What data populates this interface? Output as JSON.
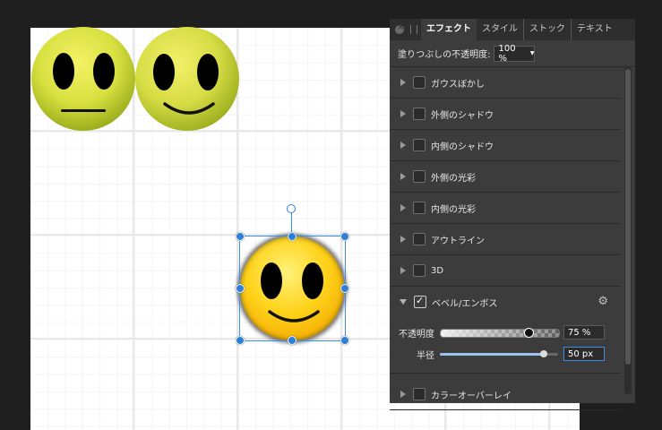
{
  "panel": {
    "tabs": [
      {
        "label": "エフェクト",
        "active": true
      },
      {
        "label": "スタイル"
      },
      {
        "label": "ストック"
      },
      {
        "label": "テキスト"
      }
    ],
    "fill_opacity_label": "塗りつぶしの不透明度:",
    "fill_opacity_value": "100 %",
    "effects": [
      {
        "label": "ガウスぼかし",
        "checked": false
      },
      {
        "label": "外側のシャドウ",
        "checked": false
      },
      {
        "label": "内側のシャドウ",
        "checked": false
      },
      {
        "label": "外側の光彩",
        "checked": false
      },
      {
        "label": "内側の光彩",
        "checked": false
      },
      {
        "label": "アウトライン",
        "checked": false
      },
      {
        "label": "3D",
        "checked": false
      },
      {
        "label": "ベベル/エンボス",
        "checked": true,
        "expanded": true
      },
      {
        "label": "カラーオーバーレイ",
        "checked": false
      }
    ],
    "bevel": {
      "opacity_label": "不透明度",
      "opacity_value": "75 %",
      "opacity_fraction": 0.75,
      "radius_label": "半径",
      "radius_value": "50 px",
      "radius_fraction": 0.88
    }
  },
  "colors": {
    "accent": "#2f7fd6",
    "panel_bg": "#3c3c3c",
    "app_bg": "#1f1f1f"
  }
}
